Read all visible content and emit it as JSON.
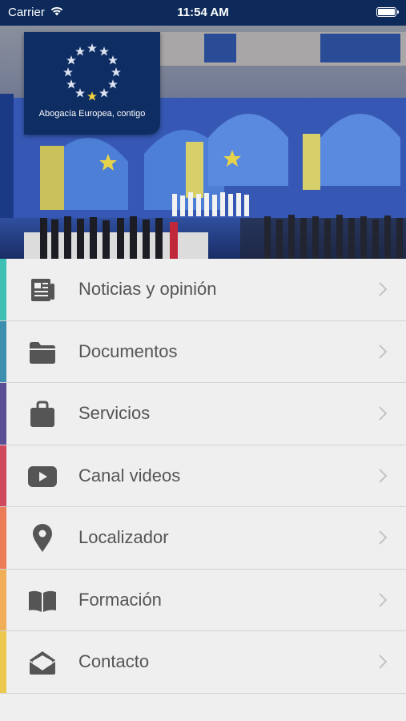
{
  "status_bar": {
    "carrier": "Carrier",
    "time": "11:54 AM"
  },
  "hero": {
    "tagline": "Abogacía Europea, contigo"
  },
  "menu": {
    "items": [
      {
        "label": "Noticias y opinión",
        "icon": "newspaper-icon",
        "accent": "#3ec1b4"
      },
      {
        "label": "Documentos",
        "icon": "folder-icon",
        "accent": "#3d8fb0"
      },
      {
        "label": "Servicios",
        "icon": "briefcase-icon",
        "accent": "#5a4e95"
      },
      {
        "label": "Canal videos",
        "icon": "video-play-icon",
        "accent": "#cf4a5c"
      },
      {
        "label": "Localizador",
        "icon": "map-pin-icon",
        "accent": "#ec7d58"
      },
      {
        "label": "Formación",
        "icon": "open-book-icon",
        "accent": "#f0ae59"
      },
      {
        "label": "Contacto",
        "icon": "envelope-icon",
        "accent": "#ecc84e"
      }
    ]
  },
  "colors": {
    "status_bar_bg": "#0d2a5a",
    "logo_bg": "#0e2d63",
    "icon_gray": "#555555",
    "chevron_gray": "#c4c4c4"
  }
}
